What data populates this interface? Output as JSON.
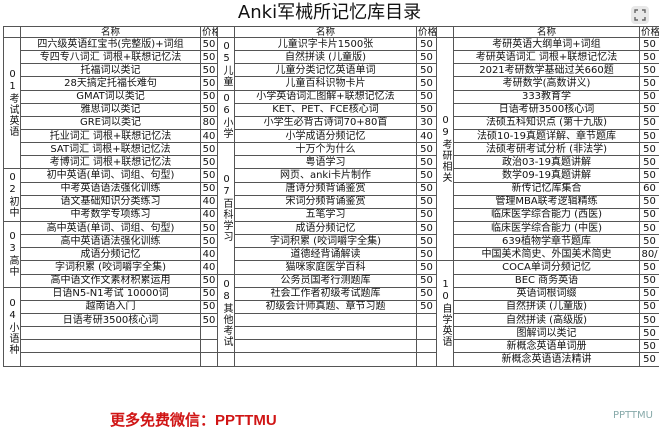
{
  "title": "Anki军械所记忆库目录",
  "headers": {
    "name": "名称",
    "price": "价格"
  },
  "col1": {
    "groups": [
      {
        "cat": "01考试英语",
        "rows": [
          [
            "四六级英语红宝书(完整版)+词组",
            "50"
          ],
          [
            "专四专八词汇 词根+联想记忆法",
            "50"
          ],
          [
            "托福词以类记",
            "50"
          ],
          [
            "28天搞定托福长难句",
            "50"
          ],
          [
            "GMAT词以类记",
            "50"
          ],
          [
            "雅思词以类记",
            "50"
          ],
          [
            "GRE词以类记",
            "80"
          ],
          [
            "托业词汇 词根+联想记忆法",
            "40"
          ],
          [
            "SAT词汇 词根+联想记忆法",
            "50"
          ],
          [
            "考博词汇 词根+联想记忆法",
            "50"
          ]
        ]
      },
      {
        "cat": "02初中",
        "rows": [
          [
            "初中英语(单词、词组、句型)",
            "50"
          ],
          [
            "中考英语语法强化训练",
            "50"
          ],
          [
            "语文基础知识分类练习",
            "40"
          ],
          [
            "中考数学专项练习",
            "40"
          ]
        ]
      },
      {
        "cat": "03高中",
        "rows": [
          [
            "高中英语(单词、词组、句型)",
            "50"
          ],
          [
            "高中英语语法强化训练",
            "50"
          ],
          [
            "成语分频记忆",
            "40"
          ],
          [
            "字词积累 (咬词嚼字全集)",
            "40"
          ],
          [
            "高中语文作文素材积累运用",
            "50"
          ]
        ]
      },
      {
        "cat": "04小语种",
        "rows": [
          [
            "日语N5-N1考试 10000词",
            "50"
          ],
          [
            "越南语入门",
            "50"
          ],
          [
            "日语考研3500核心词",
            "50"
          ],
          [
            "",
            ""
          ],
          [
            "",
            ""
          ],
          [
            "",
            ""
          ]
        ]
      }
    ]
  },
  "col2": {
    "groups": [
      {
        "cat": "05儿童",
        "rows": [
          [
            "儿童识字卡片1500张",
            "50"
          ],
          [
            "自然拼读 (儿童版)",
            "50"
          ],
          [
            "儿童分类记忆英语单词",
            "50"
          ],
          [
            "儿童百科识物卡片",
            "50"
          ]
        ]
      },
      {
        "cat": "06小学",
        "rows": [
          [
            "小学英语词汇图解+联想记忆法",
            "50"
          ],
          [
            "KET、PET、FCE核心词",
            "50"
          ],
          [
            "小学生必背古诗词70+80首",
            "30"
          ],
          [
            "小学成语分频记忆",
            "40"
          ]
        ]
      },
      {
        "cat": "07百科学习",
        "rows": [
          [
            "十万个为什么",
            "50"
          ],
          [
            "粤语学习",
            "50"
          ],
          [
            "网页、anki卡片制作",
            "50"
          ],
          [
            "唐诗分频背诵鉴赏",
            "50"
          ],
          [
            "宋词分频背诵鉴赏",
            "50"
          ],
          [
            "五笔学习",
            "50"
          ],
          [
            "成语分频记忆",
            "50"
          ],
          [
            "字词积累 (咬词嚼字全集)",
            "50"
          ],
          [
            "道德经背诵解读",
            "50"
          ],
          [
            "猫咪家庭医学百科",
            "50"
          ]
        ]
      },
      {
        "cat": "08其他考试",
        "rows": [
          [
            "公务员国考行测题库",
            "50"
          ],
          [
            "社会工作者初级考试题库",
            "50"
          ],
          [
            "初级会计师真题、章节习题",
            "50"
          ],
          [
            "",
            ""
          ],
          [
            "",
            ""
          ],
          [
            "",
            ""
          ]
        ]
      }
    ]
  },
  "col3": {
    "groups": [
      {
        "cat": "09考研相关",
        "rows": [
          [
            "考研英语大纲单词+词组",
            "50"
          ],
          [
            "考研英语词汇 词根+联想记忆法",
            "50"
          ],
          [
            "2021考研数学基础过关660题",
            "50"
          ],
          [
            "考研数学(高数讲义)",
            "50"
          ],
          [
            "333教育学",
            "50"
          ],
          [
            "日语考研3500核心词",
            "50"
          ],
          [
            "法硕五科知识点 (第十九版)",
            "50"
          ],
          [
            "法硕10-19真题详解、章节题库",
            "50"
          ],
          [
            "法硕考研考试分析 (非法学)",
            "50"
          ],
          [
            "政治03-19真题讲解",
            "50"
          ],
          [
            "数学09-19真题讲解",
            "50"
          ],
          [
            "新传记忆库集合",
            "60"
          ],
          [
            "管理MBA联考逻辑精练",
            "50"
          ],
          [
            "临床医学综合能力 (西医)",
            "50"
          ],
          [
            "临床医学综合能力 (中医)",
            "50"
          ],
          [
            "639植物学章节题库",
            "50"
          ],
          [
            "中国美术简史、外国美术简史",
            "80/"
          ]
        ]
      },
      {
        "cat": "10自学英语",
        "rows": [
          [
            "COCA单词分频记忆",
            "50"
          ],
          [
            "BEC 商务英语",
            "50"
          ],
          [
            "英语词根词缀",
            "50"
          ],
          [
            "自然拼读 (儿童版)",
            "50"
          ],
          [
            "自然拼读 (高级版)",
            "50"
          ],
          [
            "图解词以类记",
            "50"
          ],
          [
            "新概念英语单词册",
            "50"
          ],
          [
            "新概念英语语法精讲",
            "50"
          ]
        ]
      }
    ]
  },
  "watermark": "更多免费微信：PPTTMU",
  "logo": "PPTTMU"
}
